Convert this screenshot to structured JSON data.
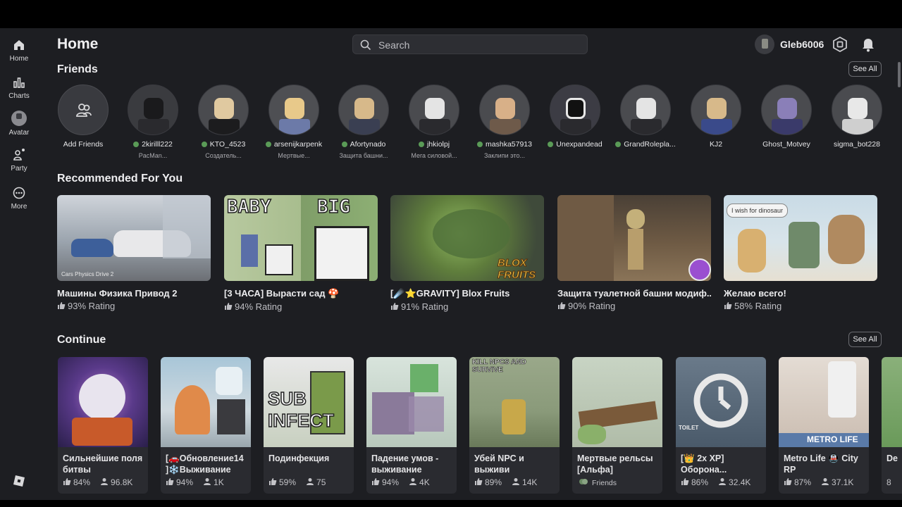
{
  "sidebar": {
    "items": [
      {
        "label": "Home",
        "icon": "home-icon"
      },
      {
        "label": "Charts",
        "icon": "charts-icon"
      },
      {
        "label": "Avatar",
        "icon": "avatar-icon"
      },
      {
        "label": "Party",
        "icon": "party-icon"
      },
      {
        "label": "More",
        "icon": "more-icon"
      }
    ]
  },
  "header": {
    "title": "Home",
    "search_placeholder": "Search",
    "username": "Gleb6006"
  },
  "friends": {
    "title": "Friends",
    "see_all": "See All",
    "add_label": "Add Friends",
    "items": [
      {
        "name": "2kirilll222",
        "status": "PacMan...",
        "online": true
      },
      {
        "name": "KTO_4523",
        "status": "Создатель...",
        "online": true
      },
      {
        "name": "arsenijkarpenk",
        "status": "Мертвые...",
        "online": true
      },
      {
        "name": "Afortynado",
        "status": "Защита башни...",
        "online": true
      },
      {
        "name": "jhkiolpj",
        "status": "Мега силовой...",
        "online": true
      },
      {
        "name": "mashka57913",
        "status": "Заклипи это...",
        "online": true
      },
      {
        "name": "Unexpandead",
        "status": "",
        "online": true
      },
      {
        "name": "GrandRolepla...",
        "status": "",
        "online": true
      },
      {
        "name": "KJ2",
        "status": "",
        "online": false
      },
      {
        "name": "Ghost_Motvey",
        "status": "",
        "online": false
      },
      {
        "name": "sigma_bot228",
        "status": "",
        "online": false
      }
    ]
  },
  "recommended": {
    "title": "Recommended For You",
    "items": [
      {
        "title": "Машины Физика Привод 2",
        "rating": "93% Rating",
        "thumb_text": "Cars Physics Drive 2"
      },
      {
        "title": "[3 ЧАСА] Вырасти сад 🍄",
        "rating": "94% Rating",
        "thumb_text_a": "BABY",
        "thumb_text_b": "BIG"
      },
      {
        "title": "[☄️⭐GRAVITY] Blox Fruits",
        "rating": "91% Rating",
        "thumb_text": "BLOX FRUITS"
      },
      {
        "title": "Защита туалетной башни модиф...",
        "rating": "90% Rating",
        "thumb_text": ""
      },
      {
        "title": "Желаю всего!",
        "rating": "58% Rating",
        "thumb_text": "I wish for dinosaur"
      }
    ]
  },
  "continue": {
    "title": "Continue",
    "see_all": "See All",
    "items": [
      {
        "title": "Сильнейшие поля битвы",
        "rating": "84%",
        "players": "96.8K"
      },
      {
        "title": "[🚗Обновление14 ]❄️Выживание в...",
        "rating": "94%",
        "players": "1K"
      },
      {
        "title": "Подинфекция",
        "rating": "59%",
        "players": "75",
        "thumb_text": "SUB INFECT"
      },
      {
        "title": "Падение умов - выживание",
        "rating": "94%",
        "players": "4K"
      },
      {
        "title": "Убей NPC и выживи",
        "rating": "89%",
        "players": "14K",
        "thumb_text": "KILL NPCS AND SURVIVE"
      },
      {
        "title": "Мертвые рельсы [Альфа]",
        "friends_label": "Friends"
      },
      {
        "title": "[👑 2x XP] Оборона...",
        "rating": "86%",
        "players": "32.4K",
        "thumb_text": "TOILET"
      },
      {
        "title": "Metro Life 🚇 City RP",
        "rating": "87%",
        "players": "37.1K",
        "thumb_text": "METRO LIFE"
      },
      {
        "title": "De",
        "rating": "8",
        "players": ""
      }
    ]
  },
  "colors": {
    "background": "#1d1e22",
    "card": "#2a2b30",
    "online": "#5a9b57"
  }
}
